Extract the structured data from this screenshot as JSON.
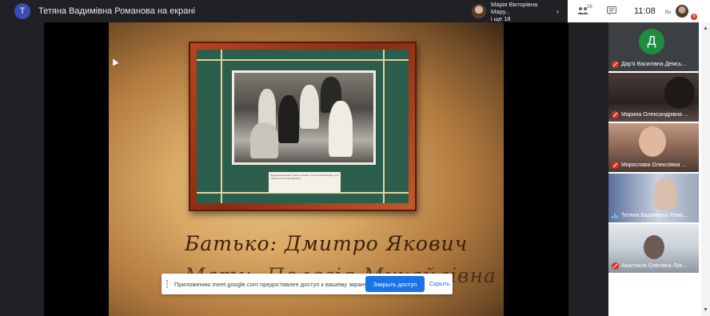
{
  "topbar": {
    "avatar_letter": "T",
    "title": "Тетяна Вадимівна Романова на екрані",
    "pinned": {
      "line1": "Марія Вікторівна Мару...",
      "line2": "і ще 18",
      "chevron": "›"
    }
  },
  "toolbar": {
    "people_icon": "people-icon",
    "people_count": "26",
    "chat_icon": "chat-icon",
    "time": "11:08",
    "short_label": "Ви",
    "badge": "8"
  },
  "slide": {
    "line1": "Батько: Дмитро Якович",
    "line2": "Мати: Пелагія Михайлівна",
    "caption": "Родина Романових. Дмитро Якович, Пелагія Михайлівна, діти і батьки Пелагії Михайлівни"
  },
  "share_banner": {
    "text": "Приложению meet.google.com предоставлен доступ к вашему экрану.",
    "stop_label": "Закрыть доступ",
    "hide_label": "Скрыть"
  },
  "participants": [
    {
      "name": "Дар'я Василівна Демсь...",
      "initial": "Д",
      "muted": true
    },
    {
      "name": "Марина Олександрівна ...",
      "muted": true
    },
    {
      "name": "Мирослава Олексіївна ...",
      "muted": true
    },
    {
      "name": "Тетяна Вадимівна Рома...",
      "muted": false
    },
    {
      "name": "Анастасія Олегівна Лук...",
      "muted": true
    }
  ],
  "colors": {
    "accent": "#1a73e8",
    "danger": "#d93025",
    "avatar_green": "#1e8e3e",
    "frame_red": "#b6451f",
    "mat_green": "#2c5e4d"
  }
}
